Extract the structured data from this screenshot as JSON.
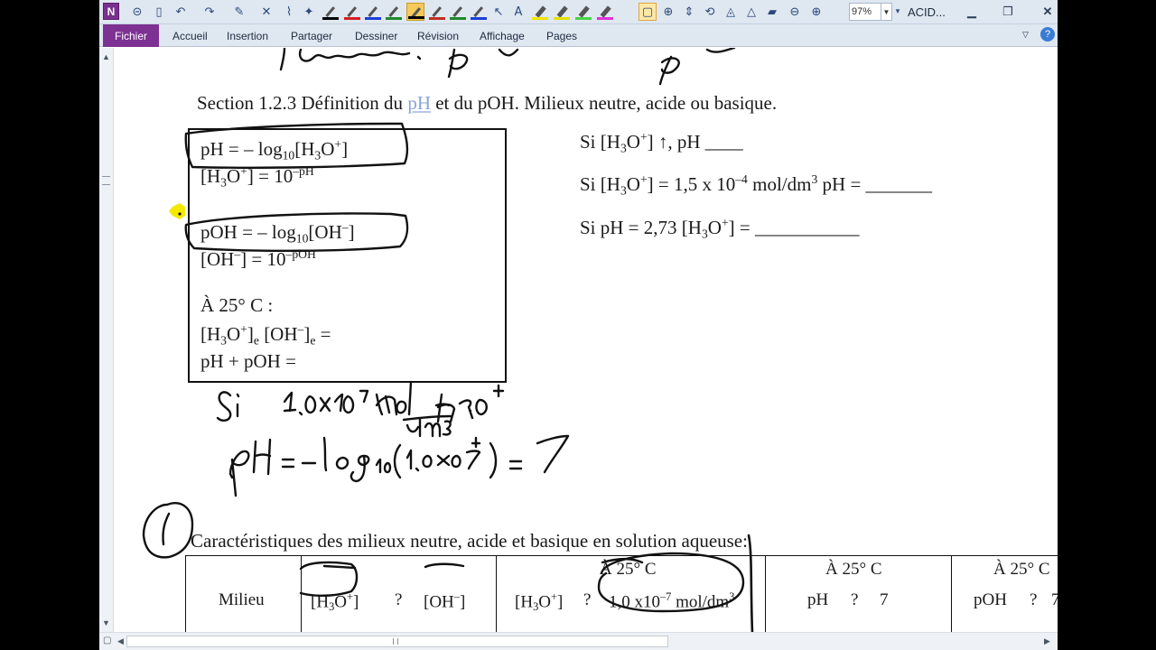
{
  "app": {
    "logo_letter": "N",
    "window_title": "ACID...",
    "zoom_value": "97%",
    "accent_color": "#7d3193"
  },
  "ribbon": {
    "file_tab": "Fichier",
    "tabs": [
      "Accueil",
      "Insertion",
      "Partager",
      "Dessiner",
      "Révision",
      "Affichage",
      "Pages"
    ]
  },
  "toolbar": {
    "pen_colors": [
      "#000000",
      "#d42020",
      "#1b3fd6",
      "#1f8a2a",
      "#c0301e",
      "#1f8a2a",
      "#1b3fd6"
    ],
    "highlighter_colors": [
      "#f4e400",
      "#e2e200",
      "#47d447",
      "#e033d8"
    ],
    "icons": [
      "back-icon",
      "dock-icon",
      "undo-icon",
      "redo-icon",
      "pen-select-icon",
      "delete-icon",
      "lasso-icon",
      "eraser-icon",
      "select-icon",
      "type-text-icon",
      "insert-space-icon",
      "rotate-icon",
      "shapes-icon",
      "zoom-out-icon",
      "zoom-in-icon"
    ]
  },
  "page": {
    "section_prefix": "Section 1.2.3  Définition du ",
    "section_link": "pH",
    "section_suffix": " et du pOH. Milieux neutre, acide ou basique.",
    "box": {
      "l1_a": "pH  = – log",
      "l1_sub": "10",
      "l1_b": "[H",
      "l1_sub2": "3",
      "l1_c": "O",
      "l1_sup": "+",
      "l1_d": "]",
      "l2_a": "[H",
      "l2_sub": "3",
      "l2_b": "O",
      "l2_sup": "+",
      "l2_c": "] = 10",
      "l2_sup2": "–pH",
      "l3_a": "pOH  = – log",
      "l3_sub": "10",
      "l3_b": "[OH",
      "l3_sup": "–",
      "l3_c": "]",
      "l4_a": "[OH",
      "l4_sup": "–",
      "l4_b": "] = 10",
      "l4_sup2": "–pOH",
      "l5": "À 25° C :",
      "l6_a": "[H",
      "l6_sub": "3",
      "l6_b": "O",
      "l6_sup": "+",
      "l6_c": "]",
      "l6_sub2": "e",
      "l6_d": " [OH",
      "l6_sup2": "–",
      "l6_e": "]",
      "l6_sub3": "e",
      "l6_f": " =",
      "l7": "pH + pOH ="
    },
    "right": {
      "r1_a": "Si [H",
      "r1_sub": "3",
      "r1_b": "O",
      "r1_sup": "+",
      "r1_c": "] ↑, pH ____",
      "r2_a": "Si [H",
      "r2_sub": "3",
      "r2_b": "O",
      "r2_sup": "+",
      "r2_c": "] = 1,5 x 10",
      "r2_sup2": "–4",
      "r2_d": " mol/dm",
      "r2_sup3": "3",
      "r2_e": "  pH = _______",
      "r3_a": "Si pH = 2,73    [H",
      "r3_sub": "3",
      "r3_b": "O",
      "r3_sup": "+",
      "r3_c": "] = ___________"
    },
    "characteristics_title": "Caractéristiques des milieux neutre, acide et basique en solution aqueuse:",
    "table": {
      "milieu": "Milieu",
      "c2_a": "[H",
      "c2_sub": "3",
      "c2_b": "O",
      "c2_sup": "+",
      "c2_c": "]",
      "c2_q": "?",
      "c2_d": "[OH",
      "c2_sup2": "–",
      "c2_e": "]",
      "c3_head": "À 25° C",
      "c3_a": "[H",
      "c3_sub": "3",
      "c3_b": "O",
      "c3_sup": "+",
      "c3_c": "]",
      "c3_q": "?",
      "c3_d": "1,0 x10",
      "c3_sup2": "–7",
      "c3_e": " mol/dm",
      "c3_sup3": "3",
      "c4_head": "À 25° C",
      "c4_a": "pH",
      "c4_q": "?",
      "c4_b": "7",
      "c5_head": "À 25° C",
      "c5_a": "pOH",
      "c5_q": "?",
      "c5_b": "7"
    }
  }
}
